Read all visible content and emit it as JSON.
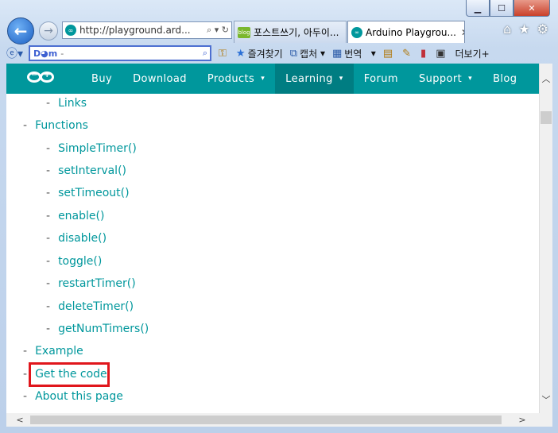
{
  "browser": {
    "address_url": "http://playground.ard...",
    "address_tools": "⌕ ▾ ↻",
    "tabs": [
      {
        "label": "포스트쓰기, 아두이...",
        "icon": "blog"
      },
      {
        "label": "Arduino Playgrou...",
        "icon": "ard",
        "close": "✕"
      }
    ],
    "toolbar": {
      "search_logo": "D◕m",
      "search_placeholder": "-",
      "items": [
        "즐겨찾기",
        "캡처",
        "번역",
        "더보기+"
      ]
    }
  },
  "site_nav": {
    "items": [
      "Buy",
      "Download",
      "Products",
      "Learning",
      "Forum",
      "Support",
      "Blog"
    ],
    "caret": "▾",
    "active": "Learning"
  },
  "toc": [
    {
      "text": "Links",
      "level": 2
    },
    {
      "text": "Functions",
      "level": 1
    },
    {
      "text": "SimpleTimer()",
      "level": 2
    },
    {
      "text": "setInterval()",
      "level": 2
    },
    {
      "text": "setTimeout()",
      "level": 2
    },
    {
      "text": "enable()",
      "level": 2
    },
    {
      "text": "disable()",
      "level": 2
    },
    {
      "text": "toggle()",
      "level": 2
    },
    {
      "text": "restartTimer()",
      "level": 2
    },
    {
      "text": "deleteTimer()",
      "level": 2
    },
    {
      "text": "getNumTimers()",
      "level": 2
    },
    {
      "text": "Example",
      "level": 1
    },
    {
      "text": "Get the code",
      "level": 1
    },
    {
      "text": "About this page",
      "level": 1
    }
  ],
  "dash": "-",
  "colors": {
    "arduino_teal": "#00979c",
    "highlight_red": "#e0161c"
  }
}
